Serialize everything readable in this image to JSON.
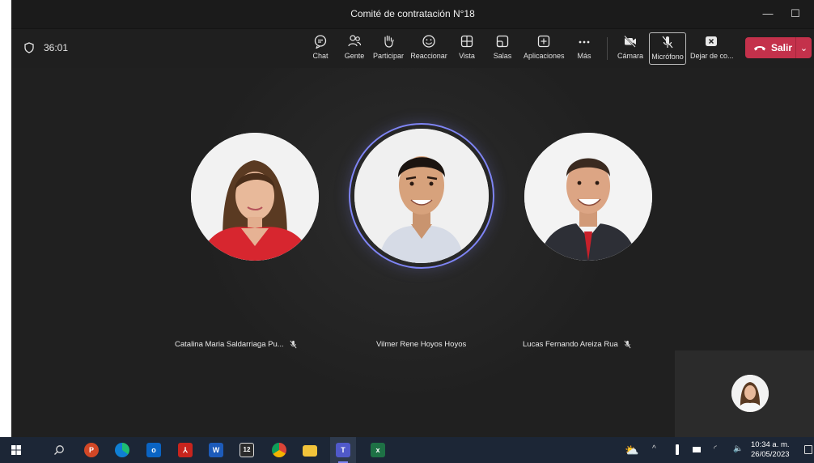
{
  "window": {
    "title": "Comité de contratación N°18",
    "minimize": "—",
    "maximize": "☐"
  },
  "meeting": {
    "elapsed": "36:01"
  },
  "toolbar": {
    "chat": "Chat",
    "people": "Gente",
    "raise_hand": "Participar",
    "react": "Reaccionar",
    "view": "Vista",
    "rooms": "Salas",
    "apps": "Aplicaciones",
    "more": "Más",
    "camera": "Cámara",
    "mic": "Micrófono",
    "share": "Dejar de co...",
    "leave": "Salir"
  },
  "participants": [
    {
      "name": "Catalina Maria Saldarriaga Pu...",
      "muted": true,
      "speaking": false
    },
    {
      "name": "Vilmer Rene Hoyos Hoyos",
      "muted": false,
      "speaking": true
    },
    {
      "name": "Lucas Fernando Areiza Rua",
      "muted": true,
      "speaking": false
    }
  ],
  "taskbar": {
    "icons": [
      "windows-start",
      "search",
      "powerpoint",
      "edge",
      "outlook",
      "acrobat",
      "word",
      "calendar",
      "chrome",
      "file-explorer",
      "teams",
      "excel"
    ],
    "word_letter": "W",
    "outlook_letter": "o",
    "excel_letter": "x",
    "powerpoint_letter": "P",
    "calendar_text": "12",
    "clock_time": "10:34 a. m.",
    "clock_date": "26/05/2023"
  },
  "colors": {
    "accent_ring": "#7f85f5",
    "leave_button": "#c4314b",
    "stage_bg": "#202020",
    "taskbar_bg": "#1c2636"
  }
}
